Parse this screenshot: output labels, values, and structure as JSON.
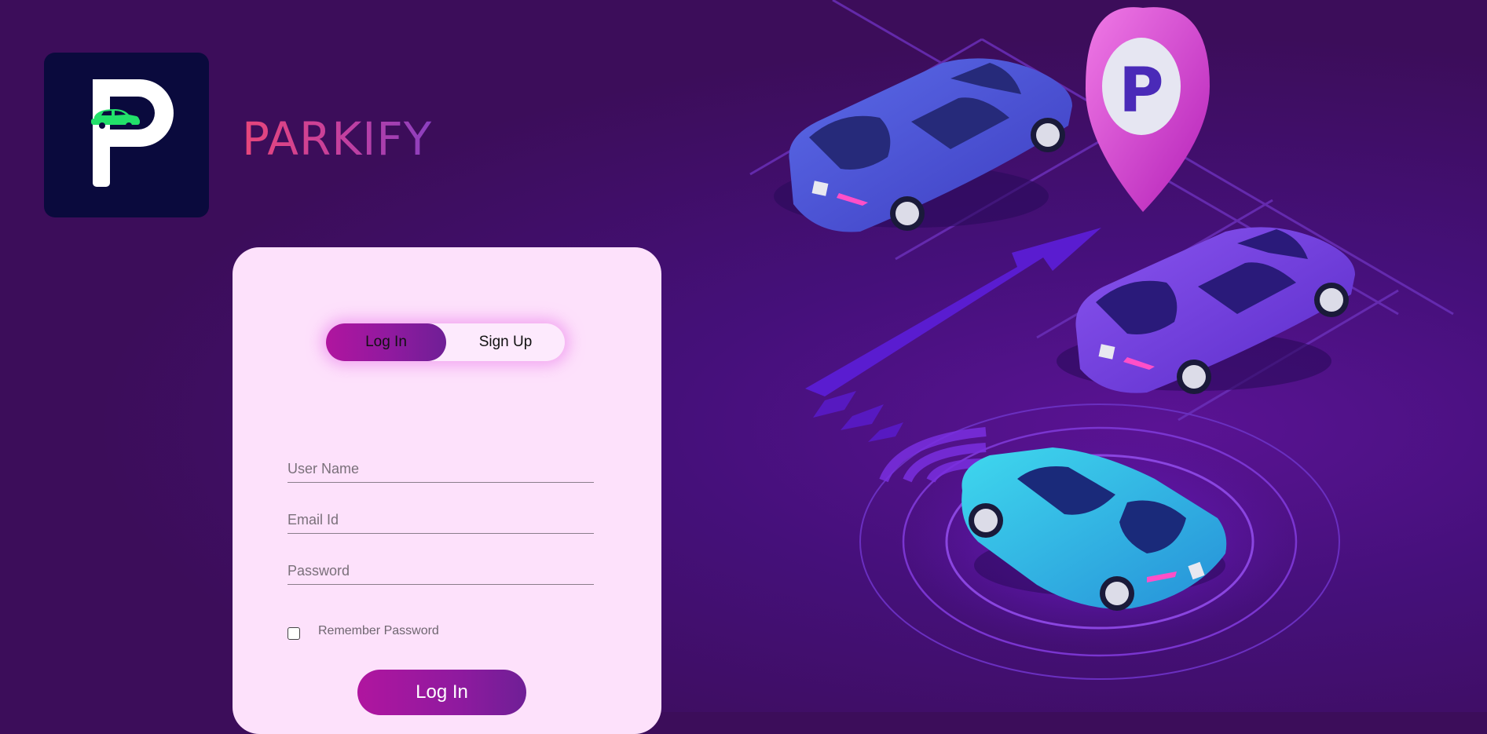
{
  "brand": {
    "name": "PARKIFY",
    "logo_icon": "parking-logo-icon"
  },
  "auth_toggle": {
    "login_label": "Log In",
    "signup_label": "Sign Up",
    "active": "login"
  },
  "form": {
    "username_placeholder": "User Name",
    "email_placeholder": "Email Id",
    "password_placeholder": "Password",
    "remember_label": "Remember Password",
    "remember_checked": false,
    "submit_label": "Log In"
  },
  "illustration": {
    "sign_letter": "P",
    "elements": [
      "blue-car-icon",
      "purple-car-icon",
      "cyan-car-icon",
      "parking-pin-icon",
      "direction-arrow-icon"
    ]
  },
  "colors": {
    "background": "#3c0d5a",
    "card": "#fde1fb",
    "accent_start": "#b0159f",
    "accent_end": "#6f1f96",
    "brand_gradient_start": "#e8467a"
  }
}
